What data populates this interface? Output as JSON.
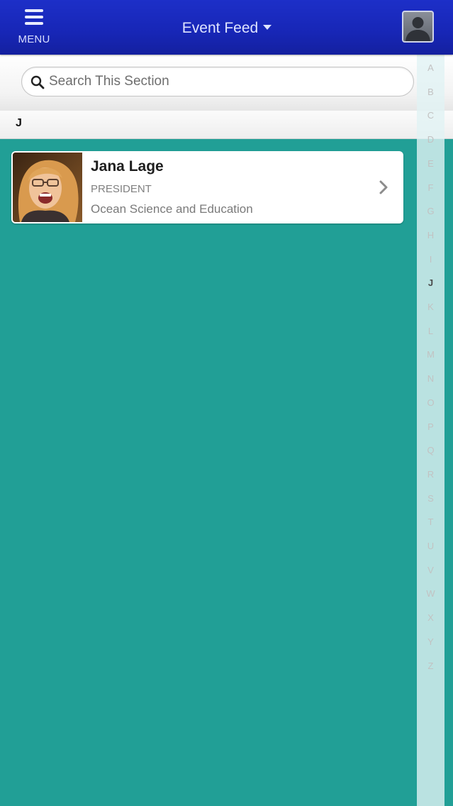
{
  "header": {
    "menu_label": "MENU",
    "title": "Event Feed"
  },
  "search": {
    "placeholder": "Search This Section"
  },
  "section": {
    "letter": "J"
  },
  "contacts": [
    {
      "name": "Jana Lage",
      "role": "PRESIDENT",
      "organization": "Ocean Science and Education"
    }
  ],
  "alphabet_index": {
    "letters": [
      "A",
      "B",
      "C",
      "D",
      "E",
      "F",
      "G",
      "H",
      "I",
      "J",
      "K",
      "L",
      "M",
      "N",
      "O",
      "P",
      "Q",
      "R",
      "S",
      "T",
      "U",
      "V",
      "W",
      "X",
      "Y",
      "Z"
    ],
    "active": "J"
  },
  "colors": {
    "header": "#1726b6",
    "background": "#219f96",
    "index_bar": "#e1f3f4"
  },
  "icons": {
    "menu": "hamburger-icon",
    "title_dropdown": "caret-down-icon",
    "profile": "user-silhouette-icon",
    "search": "search-icon",
    "row_action": "chevron-right-icon"
  }
}
